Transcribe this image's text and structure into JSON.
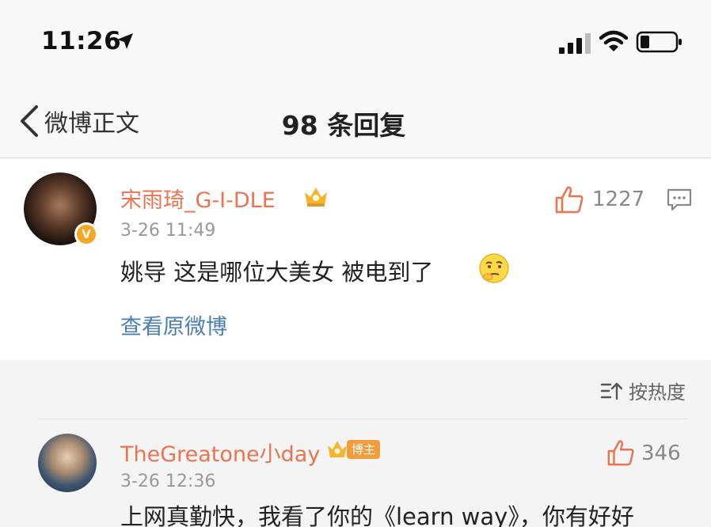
{
  "status_bar": {
    "time": "11:26",
    "icons": [
      "location-arrow-icon",
      "signal-icon",
      "wifi-icon",
      "battery-icon"
    ]
  },
  "nav": {
    "back_label": "微博正文",
    "title": "98 条回复"
  },
  "main_comment": {
    "username": "宋雨琦_G-I-DLE",
    "verified_badge": "V",
    "timestamp": "3-26 11:49",
    "text": "姚导 这是哪位大美女 被电到了",
    "like_count": "1227",
    "view_original": "查看原微博"
  },
  "sort": {
    "label": "按热度"
  },
  "reply": {
    "username": "TheGreatone小day",
    "author_badge": "博主",
    "timestamp": "3-26 12:36",
    "text": "上网真勤快，我看了你的《learn way》，你有好好",
    "like_count": "346"
  },
  "colors": {
    "username": "#eb7350",
    "link": "#4a7eb5",
    "like_icon": "#eb7350",
    "badge": "#f6a623"
  }
}
